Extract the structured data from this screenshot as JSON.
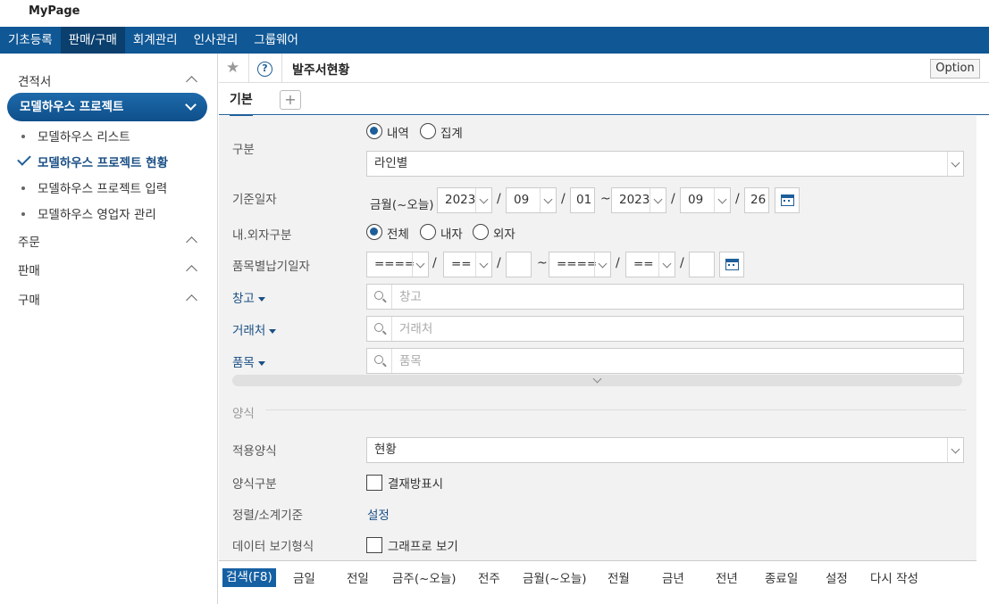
{
  "top": {
    "mypage": "MyPage"
  },
  "nav": [
    "기초등록",
    "판매/구매",
    "회계관리",
    "인사관리",
    "그룹웨어"
  ],
  "sidebar": {
    "group_quote": "견적서",
    "active": "모델하우스 프로젝트",
    "sub": [
      "모델하우스 리스트",
      "모델하우스 프로젝트 현황",
      "모델하우스 프로젝트 입력",
      "모델하우스 영업자 관리"
    ],
    "groups": [
      "주문",
      "판매",
      "구매"
    ]
  },
  "header": {
    "title": "발주서현황",
    "option": "Option",
    "help": "?",
    "star": "★"
  },
  "tabs": {
    "basic": "기본",
    "add": "+"
  },
  "form": {
    "gubun": {
      "label": "구분",
      "opt1": "내역",
      "opt2": "집계",
      "select": "라인별"
    },
    "date": {
      "label": "기준일자",
      "preset": "금월(~오늘)",
      "y1": "2023",
      "m1": "09",
      "d1": "01",
      "tilde": "~",
      "y2": "2023",
      "m2": "09",
      "d2": "26",
      "slash": "/"
    },
    "inout": {
      "label": "내.외자구분",
      "opt1": "전체",
      "opt2": "내자",
      "opt3": "외자"
    },
    "itemdate": {
      "label": "품목별납기일자",
      "y": "====",
      "m": "==",
      "tilde": "~"
    },
    "warehouse": {
      "label": "창고",
      "placeholder": "창고"
    },
    "client": {
      "label": "거래처",
      "placeholder": "거래처"
    },
    "item": {
      "label": "품목",
      "placeholder": "품목"
    },
    "section": "양식",
    "template": {
      "label": "적용양식",
      "select": "현황"
    },
    "formtype": {
      "label": "양식구분",
      "check": "결재방표시"
    },
    "sort": {
      "label": "정렬/소계기준",
      "link": "설정"
    },
    "view": {
      "label": "데이터 보기형식",
      "check": "그래프로 보기"
    }
  },
  "bottom": [
    "검색(F8)",
    "금일",
    "전일",
    "금주(~오늘)",
    "전주",
    "금월(~오늘)",
    "전월",
    "금년",
    "전년",
    "종료일",
    "설정",
    "다시 작성"
  ],
  "colors": {
    "nav": "#0f5795",
    "accent": "#1e5f99"
  }
}
